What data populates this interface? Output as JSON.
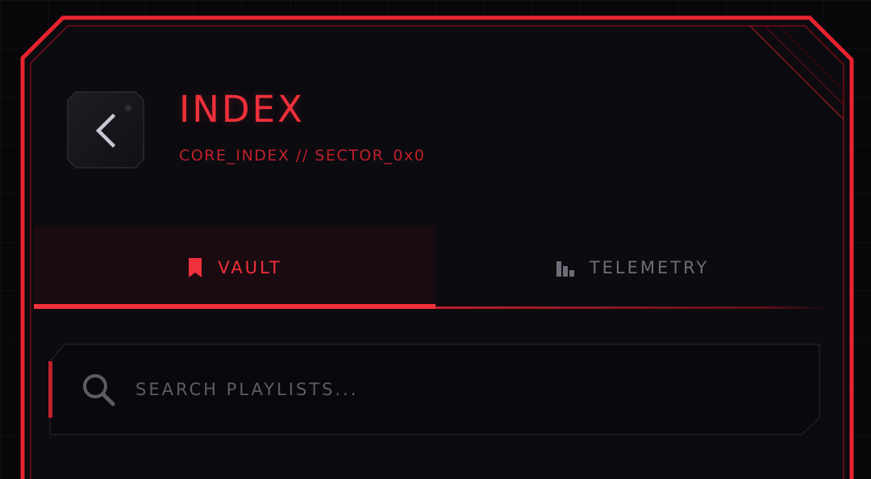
{
  "header": {
    "title": "INDEX",
    "subtitle": "CORE_INDEX // SECTOR_0x0"
  },
  "back_button": {
    "icon": "chevron-left-icon"
  },
  "tabs": [
    {
      "label": "VAULT",
      "icon": "bookmark-icon",
      "active": true
    },
    {
      "label": "TELEMETRY",
      "icon": "bar-chart-icon",
      "active": false
    }
  ],
  "search": {
    "placeholder": "SEARCH PLAYLISTS...",
    "value": "",
    "icon": "search-icon"
  },
  "colors": {
    "accent": "#f0303b",
    "accent_dark": "#c0202c",
    "background": "#07070a",
    "panel": "#0b0b10",
    "muted_text": "#6e6e78"
  }
}
